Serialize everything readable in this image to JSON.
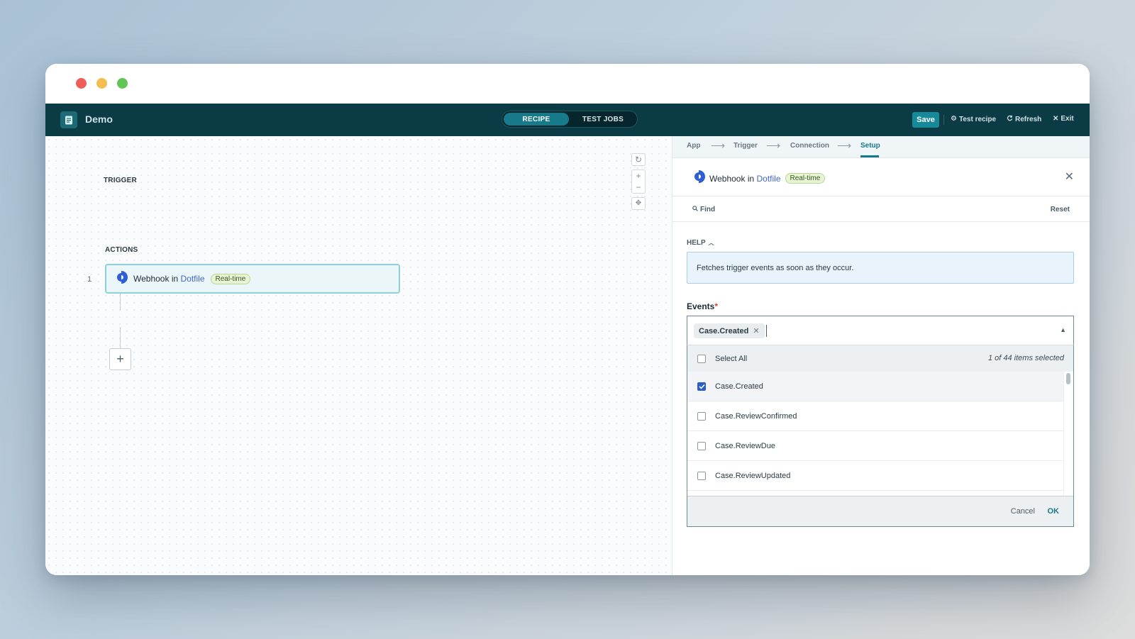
{
  "app": {
    "name": "Demo"
  },
  "tabs": {
    "recipe": "RECIPE",
    "test_jobs": "TEST JOBS"
  },
  "toolbar": {
    "save": "Save",
    "test_recipe": "Test recipe",
    "refresh": "Refresh",
    "exit": "Exit"
  },
  "canvas": {
    "trigger_label": "TRIGGER",
    "actions_label": "ACTIONS",
    "step_number": "1",
    "trigger": {
      "prefix": "Webhook in",
      "app": "Dotfile",
      "badge": "Real-time"
    },
    "add_label": "+"
  },
  "panel": {
    "steps": [
      "App",
      "Trigger",
      "Connection",
      "Setup"
    ],
    "active_step": "Setup",
    "header": {
      "prefix": "Webhook in",
      "app": "Dotfile",
      "badge": "Real-time"
    },
    "find": "Find",
    "reset": "Reset",
    "help_label": "HELP",
    "help_text": "Fetches trigger events as soon as they occur.",
    "events_label": "Events",
    "required_mark": "*",
    "chip": "Case.Created",
    "select_all": "Select All",
    "selected_count": "1 of 44 items selected",
    "options": [
      {
        "label": "Case.Created",
        "checked": true
      },
      {
        "label": "Case.ReviewConfirmed",
        "checked": false
      },
      {
        "label": "Case.ReviewDue",
        "checked": false
      },
      {
        "label": "Case.ReviewUpdated",
        "checked": false
      }
    ],
    "cancel": "Cancel",
    "ok": "OK"
  },
  "colors": {
    "appbar": "#0b3b45",
    "accent": "#16798a",
    "link": "#3f67c9",
    "checkbox_checked": "#2b5fc9"
  }
}
